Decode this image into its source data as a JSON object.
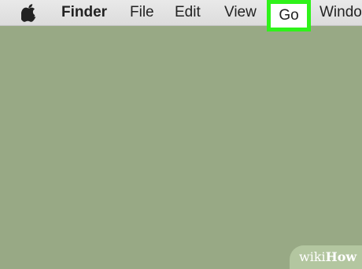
{
  "menubar": {
    "apple_icon": "apple-logo-icon",
    "items": [
      {
        "label": "Finder"
      },
      {
        "label": "File"
      },
      {
        "label": "Edit"
      },
      {
        "label": "View"
      },
      {
        "label": "Go",
        "highlight_color": "#2ff21a"
      },
      {
        "label": "Windo"
      }
    ]
  },
  "desktop": {
    "background_color": "#98a985"
  },
  "watermark": {
    "prefix": "wiki",
    "suffix": "How"
  }
}
